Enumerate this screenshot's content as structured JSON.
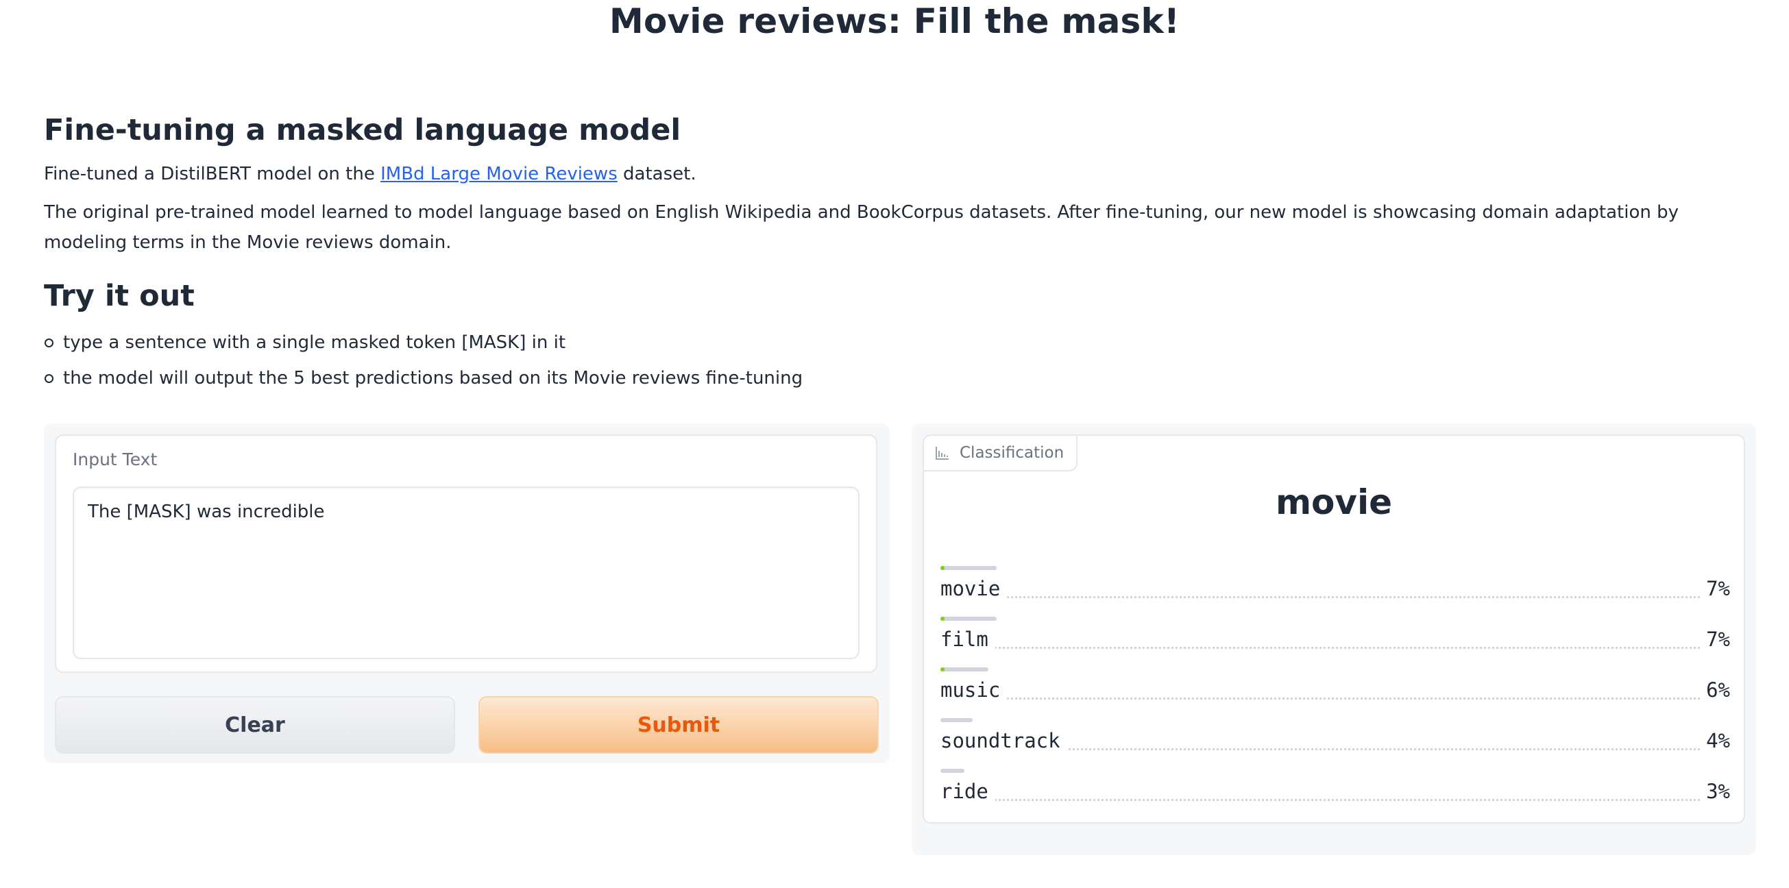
{
  "title": "Movie reviews: Fill the mask!",
  "description": {
    "heading": "Fine-tuning a masked language model",
    "p1_before": "Fine-tuned a DistilBERT model on the ",
    "p1_link": "IMBd Large Movie Reviews",
    "p1_after": " dataset.",
    "p2": "The original pre-trained model learned to model language based on English Wikipedia and BookCorpus datasets. After fine-tuning, our new model is showcasing domain adaptation by modeling terms in the Movie reviews domain.",
    "try_heading": "Try it out",
    "bullets": [
      "type a sentence with a single masked token [MASK] in it",
      "the model will output the 5 best predictions based on its Movie reviews fine-tuning"
    ]
  },
  "input": {
    "label": "Input Text",
    "value": "The [MASK] was incredible"
  },
  "buttons": {
    "clear": "Clear",
    "submit": "Submit"
  },
  "output": {
    "tab_label": "Classification",
    "icon": "bar-chart-icon",
    "top_label": "movie",
    "confidences": [
      {
        "label": "movie",
        "value": "7%",
        "fraction": 0.07
      },
      {
        "label": "film",
        "value": "7%",
        "fraction": 0.07
      },
      {
        "label": "music",
        "value": "6%",
        "fraction": 0.06
      },
      {
        "label": "soundtrack",
        "value": "4%",
        "fraction": 0.04
      },
      {
        "label": "ride",
        "value": "3%",
        "fraction": 0.03
      }
    ]
  },
  "colors": {
    "link": "#2563eb",
    "accent_orange": "#ea580c",
    "confidence_bar": "#84cc16"
  }
}
